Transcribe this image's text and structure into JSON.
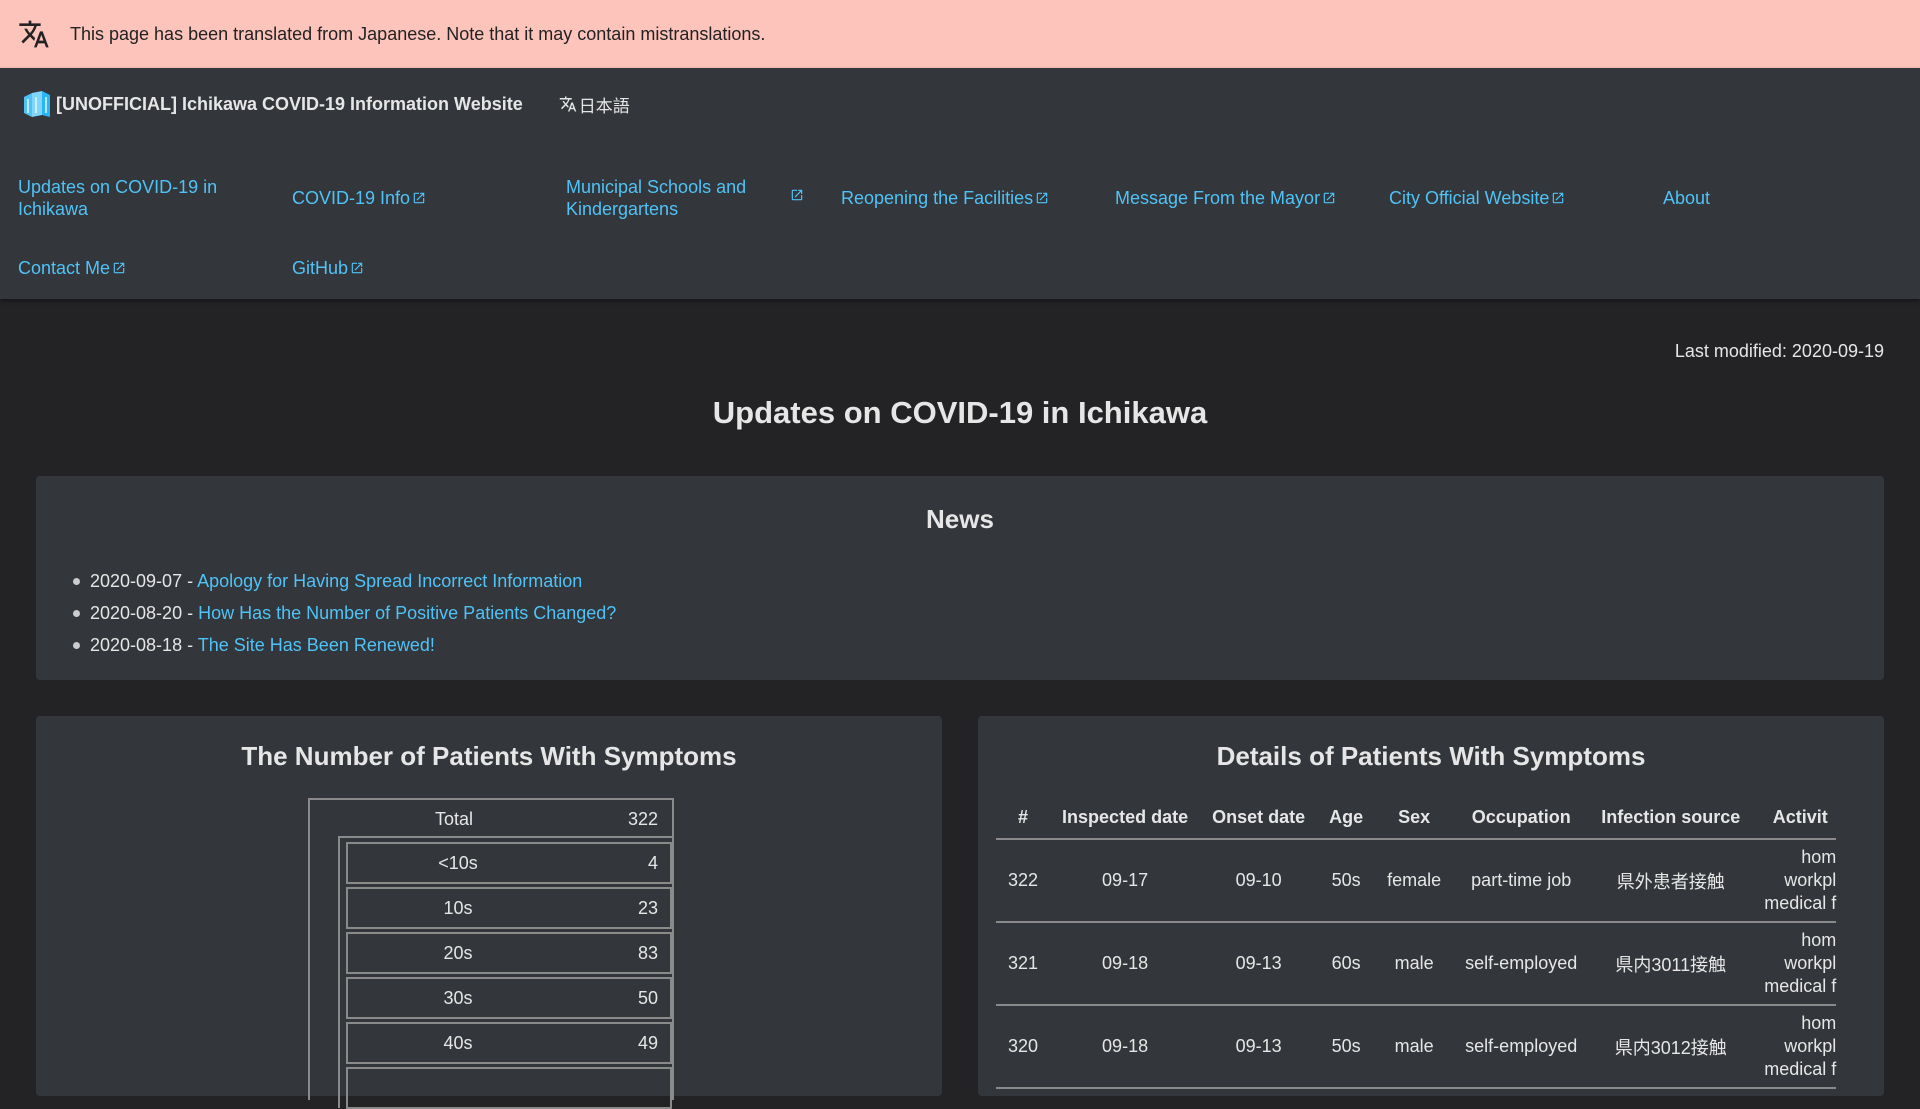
{
  "translation_banner": {
    "text": "This page has been translated from Japanese. Note that it may contain mistranslations."
  },
  "header": {
    "site_title": "[UNOFFICIAL] Ichikawa COVID-19 Information Website",
    "language": "日本語"
  },
  "nav": {
    "items": [
      {
        "label": "Updates on COVID-19 in Ichikawa",
        "external": false
      },
      {
        "label": "COVID-19 Info",
        "external": true
      },
      {
        "label": "Municipal Schools and Kindergartens",
        "external": true
      },
      {
        "label": "Reopening the Facilities",
        "external": true
      },
      {
        "label": "Message From the Mayor",
        "external": true
      },
      {
        "label": "City Official Website",
        "external": true
      },
      {
        "label": "About",
        "external": false
      },
      {
        "label": "Contact Me",
        "external": true
      },
      {
        "label": "GitHub",
        "external": true
      }
    ]
  },
  "main": {
    "last_modified": "Last modified: 2020-09-19",
    "page_title": "Updates on COVID-19 in Ichikawa"
  },
  "news": {
    "title": "News",
    "items": [
      {
        "date": "2020-09-07 - ",
        "link": "Apology for Having Spread Incorrect Information"
      },
      {
        "date": "2020-08-20 - ",
        "link": "How Has the Number of Positive Patients Changed?"
      },
      {
        "date": "2020-08-18 - ",
        "link": "The Site Has Been Renewed!"
      }
    ]
  },
  "patients_chart": {
    "title": "The Number of Patients With Symptoms",
    "total_label": "Total",
    "total_value": "322",
    "rows": [
      {
        "label": "<10s",
        "value": "4"
      },
      {
        "label": "10s",
        "value": "23"
      },
      {
        "label": "20s",
        "value": "83"
      },
      {
        "label": "30s",
        "value": "50"
      },
      {
        "label": "40s",
        "value": "49"
      }
    ]
  },
  "details_table": {
    "title": "Details of Patients With Symptoms",
    "headers": [
      "#",
      "Inspected date",
      "Onset date",
      "Age",
      "Sex",
      "Occupation",
      "Infection source",
      "Activit"
    ],
    "rows": [
      [
        "322",
        "09-17",
        "09-10",
        "50s",
        "female",
        "part-time job",
        "県外患者接触",
        "hom",
        "workpl",
        "medical f"
      ],
      [
        "321",
        "09-18",
        "09-13",
        "60s",
        "male",
        "self-employed",
        "県内3011接触",
        "hom",
        "workpl",
        "medical f"
      ],
      [
        "320",
        "09-18",
        "09-13",
        "50s",
        "male",
        "self-employed",
        "県内3012接触",
        "hom",
        "workpl",
        "medical f"
      ]
    ]
  },
  "colors": {
    "banner_bg": "#fdc4bb",
    "header_bg": "#33363a",
    "page_bg": "#232326",
    "link": "#4fc3f7"
  }
}
